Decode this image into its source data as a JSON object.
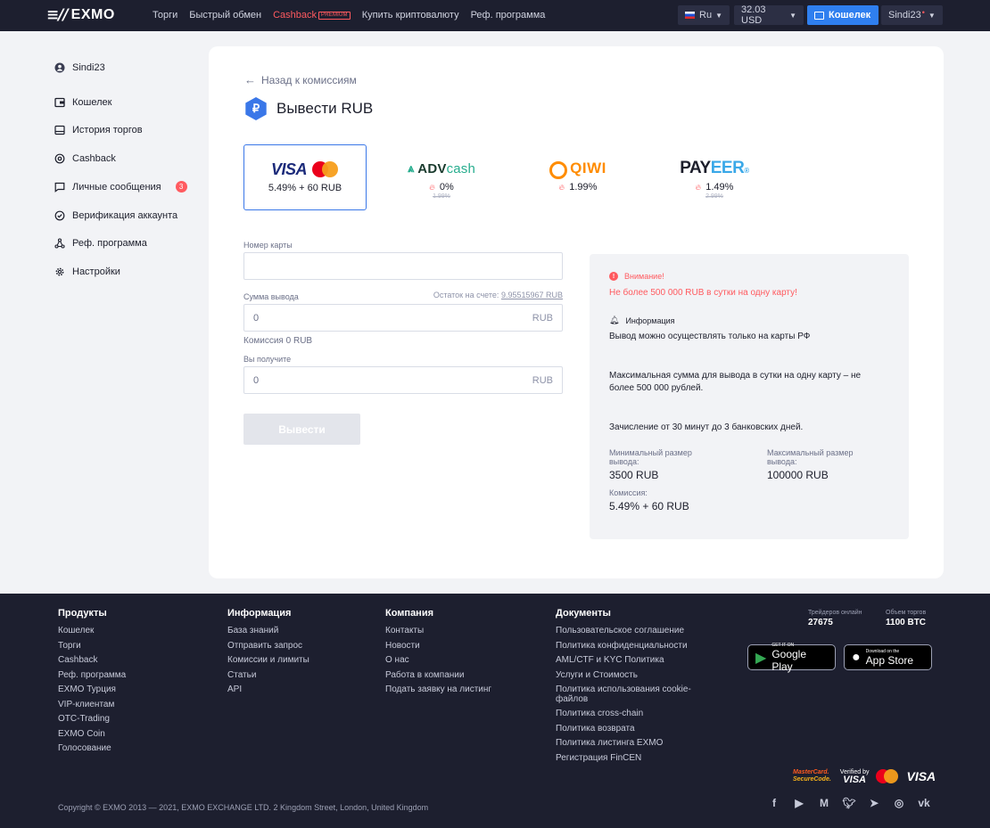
{
  "header": {
    "logo": "EXMO",
    "nav": [
      "Торги",
      "Быстрый обмен",
      "Cashback",
      "Купить криптовалюту",
      "Реф. программа"
    ],
    "premium_badge": "PREMIUM",
    "lang": "Ru",
    "balance": "32.03 USD",
    "wallet": "Кошелек",
    "user": "Sindi23"
  },
  "sidebar": {
    "items": [
      {
        "label": "Sindi23",
        "icon": "user-icon"
      },
      {
        "label": "Кошелек",
        "icon": "wallet-icon"
      },
      {
        "label": "История торгов",
        "icon": "history-icon"
      },
      {
        "label": "Cashback",
        "icon": "cashback-icon"
      },
      {
        "label": "Личные сообщения",
        "icon": "message-icon",
        "badge": "3"
      },
      {
        "label": "Верификация аккаунта",
        "icon": "check-icon"
      },
      {
        "label": "Реф. программа",
        "icon": "referral-icon"
      },
      {
        "label": "Настройки",
        "icon": "gear-icon"
      }
    ]
  },
  "main": {
    "back": "Назад к комиссиям",
    "title": "Вывести RUB",
    "currency_symbol": "₽",
    "methods": [
      {
        "name": "VISA",
        "fee": "5.49% + 60 RUB",
        "old_fee": ""
      },
      {
        "name": "ADVcash",
        "fee": "0%",
        "old_fee": "1.99%"
      },
      {
        "name": "QIWI",
        "fee": "1.99%",
        "old_fee": ""
      },
      {
        "name": "PAYEER",
        "fee": "1.49%",
        "old_fee": "2.99%"
      }
    ],
    "form": {
      "card_label": "Номер карты",
      "card_value": "",
      "amount_label": "Сумма вывода",
      "balance_label": "Остаток на счете:",
      "balance_value": "9.95515967 RUB",
      "amount_value": "0",
      "currency": "RUB",
      "fee_note": "Комиссия 0 RUB",
      "receive_label": "Вы получите",
      "receive_value": "0",
      "submit": "Вывести"
    },
    "info": {
      "warn_title": "Внимание!",
      "warn_text": "Не более 500 000 RUB в сутки на одну карту!",
      "info_title": "Информация",
      "p1": "Вывод можно осуществлять только на карты РФ",
      "p2": "Максимальная сумма для вывода в сутки на одну карту – не более 500 000 рублей.",
      "p3": "Зачисление от 30 минут до 3 банковских дней.",
      "min_label": "Минимальный размер вывода:",
      "min_value": "3500 RUB",
      "max_label": "Максимальный размер вывода:",
      "max_value": "100000 RUB",
      "fee_label": "Комиссия:",
      "fee_value": "5.49% + 60 RUB"
    }
  },
  "footer": {
    "products": {
      "title": "Продукты",
      "links": [
        "Кошелек",
        "Торги",
        "Cashback",
        "Реф. программа",
        "EXMO Турция",
        "VIP-клиентам",
        "OTC-Trading",
        "EXMO Coin",
        "Голосование"
      ]
    },
    "info": {
      "title": "Информация",
      "links": [
        "База знаний",
        "Отправить запрос",
        "Комиссии и лимиты",
        "Статьи",
        "API"
      ]
    },
    "company": {
      "title": "Компания",
      "links": [
        "Контакты",
        "Новости",
        "О нас",
        "Работа в компании",
        "Подать заявку на листинг"
      ]
    },
    "docs": {
      "title": "Документы",
      "links": [
        "Пользовательское соглашение",
        "Политика конфиденциальности",
        "AML/CTF и KYC Политика",
        "Услуги и Стоимость",
        "Политика использования cookie-файлов",
        "Политика cross-chain",
        "Политика возврата",
        "Политика листинга EXMO",
        "Регистрация FinCEN"
      ]
    },
    "traders_label": "Трейдеров онлайн",
    "traders_value": "27675",
    "volume_label": "Объем торгов",
    "volume_value": "1100 BTC",
    "google_small": "GET IT ON",
    "google_big": "Google Play",
    "apple_small": "Download on the",
    "apple_big": "App Store",
    "mc_secure_line1": "MasterCard.",
    "mc_secure_line2": "SecureCode.",
    "verified_line1": "Verified by",
    "verified_line2": "VISA",
    "visa": "VISA",
    "copyright": "Copyright © EXMO 2013 — 2021, EXMO EXCHANGE LTD. 2 Kingdom Street, London, United Kingdom"
  }
}
